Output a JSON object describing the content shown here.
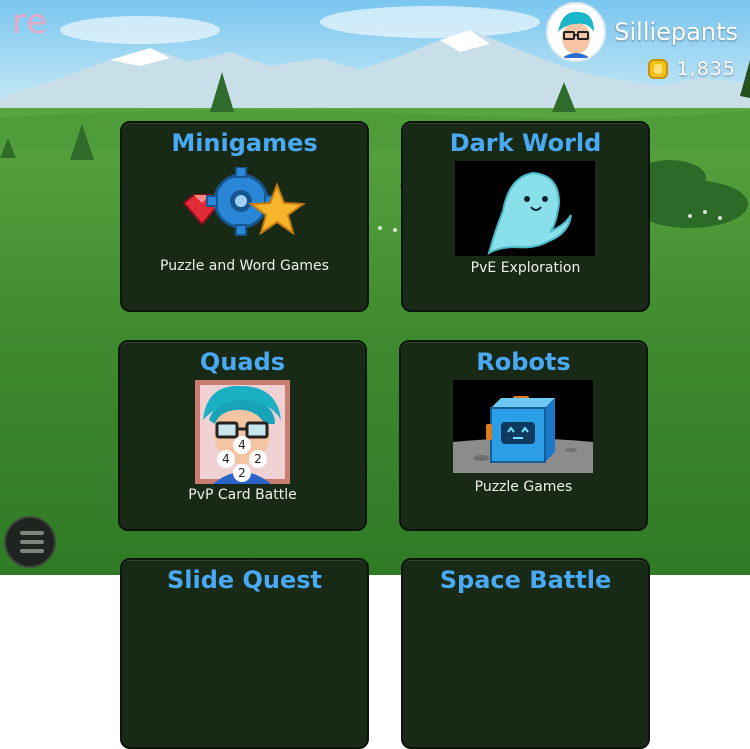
{
  "header": {
    "logo": "re",
    "username": "Silliepants",
    "coins": "1,835"
  },
  "icons": {
    "avatar": "avatar-icon",
    "coin": "coin-icon",
    "menu": "hamburger-menu-icon"
  },
  "colors": {
    "title": "#49a9f4",
    "card_bg": "#182a15",
    "grass": "#3f8a2e",
    "sky": "#b7e0f3"
  },
  "cards": [
    {
      "title": "Minigames",
      "subtitle": "Puzzle and Word Games"
    },
    {
      "title": "Dark World",
      "subtitle": "PvE Exploration"
    },
    {
      "title": "Quads",
      "subtitle": "PvP Card Battle",
      "card_numbers": [
        "4",
        "4",
        "2",
        "2"
      ]
    },
    {
      "title": "Robots",
      "subtitle": "Puzzle Games"
    },
    {
      "title": "Slide Quest",
      "subtitle": ""
    },
    {
      "title": "Space Battle",
      "subtitle": ""
    }
  ]
}
